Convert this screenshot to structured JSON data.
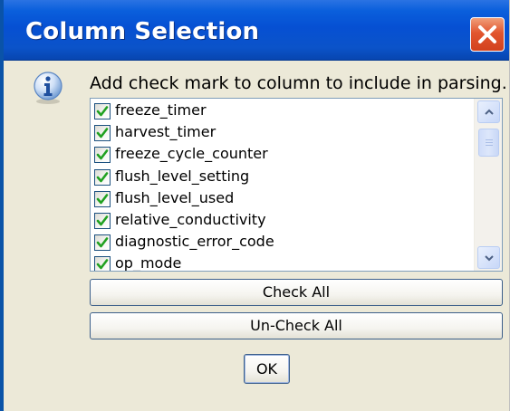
{
  "window": {
    "title": "Column Selection",
    "close_icon": "close-x-icon"
  },
  "dialog": {
    "icon": "info-icon",
    "instruction": "Add check mark to column to include in parsing."
  },
  "columns": [
    {
      "label": "freeze_timer",
      "checked": true
    },
    {
      "label": "harvest_timer",
      "checked": true
    },
    {
      "label": "freeze_cycle_counter",
      "checked": true
    },
    {
      "label": "flush_level_setting",
      "checked": true
    },
    {
      "label": "flush_level_used",
      "checked": true
    },
    {
      "label": "relative_conductivity",
      "checked": true
    },
    {
      "label": "diagnostic_error_code",
      "checked": true
    },
    {
      "label": "op_mode",
      "checked": true
    }
  ],
  "buttons": {
    "check_all": "Check All",
    "uncheck_all": "Un-Check All",
    "ok": "OK"
  },
  "colors": {
    "titlebar": "#0650d3",
    "close_button": "#d2411d",
    "dialog_background": "#ece9d8",
    "checkmark": "#21a121"
  }
}
